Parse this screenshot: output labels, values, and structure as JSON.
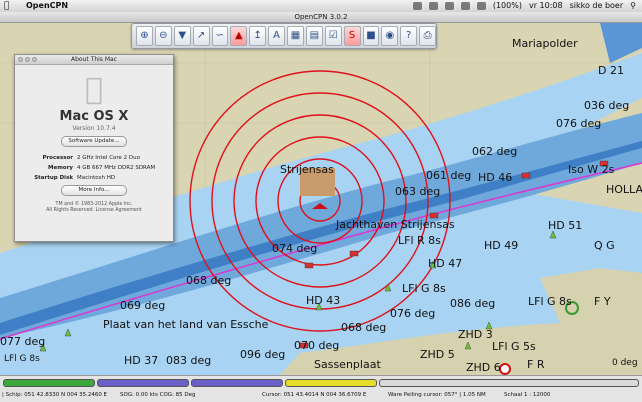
{
  "menubar": {
    "app": "OpenCPN",
    "battery": "(100%)",
    "clock": "vr 10:08",
    "user": "sikko de boer"
  },
  "window": {
    "title": "OpenCPN 3.0.2"
  },
  "toolbar": {
    "buttons": [
      "zoom-in",
      "zoom-out",
      "course-up",
      "route",
      "track",
      "pirate",
      "measure",
      "text",
      "cm93",
      "tide",
      "settings",
      "drop-mark",
      "ais",
      "help",
      "print",
      "quit"
    ]
  },
  "about": {
    "title": "About This Mac",
    "os": "Mac OS X",
    "version": "Version 10.7.4",
    "update_button": "Software Update...",
    "processor_label": "Processor",
    "processor": "2 GHz Intel Core 2 Duo",
    "memory_label": "Memory",
    "memory": "4 GB 667 MHz DDR2 SDRAM",
    "disk_label": "Startup Disk",
    "disk": "Macintosh HD",
    "more_button": "More Info...",
    "footer1": "TM and © 1983-2012 Apple Inc.",
    "footer2": "All Rights Reserved.  License Agreement"
  },
  "chart_labels": [
    "Mariapolder",
    "D 21",
    "036 deg",
    "076 deg",
    "062 deg",
    "061 deg",
    "HD 46",
    "Iso W 2s",
    "HOLLA",
    "063 deg",
    "Strijensas",
    "Jachthaven Strijensas",
    "LFl R 8s",
    "HD 51",
    "074 deg",
    "HD 49",
    "Q G",
    "HD 47",
    "068 deg",
    "LFl G 8s",
    "069 deg",
    "HD 43",
    "086 deg",
    "LFl G 8s",
    "F Y",
    "076 deg",
    "Plaat van het land van Essche",
    "068 deg",
    "ZHD 3",
    "077 deg",
    "070 deg",
    "LFl G 5s",
    "HD 37",
    "083 deg",
    "096 deg",
    "Sassenplaat",
    "ZHD 5",
    "ZHD 6",
    "F R",
    "LFl G 8s",
    "0 deg"
  ],
  "status": {
    "ship": "| Schip: 051 42.8330 N   004 35.2460 E",
    "sog": "SOG:   0.00 kts   COG:   85 Deg",
    "cursor": "Cursor: 051 43.4014 N   004 36.6709 E",
    "bearing": "Ware Peiling cursor: 057° |  1.05 NM",
    "scale": "Schaal 1 :    12000"
  },
  "colors": {
    "water": "#a9d3f0",
    "deep": "#3b78c0",
    "land": "#d6d2b0",
    "rings": "#e0101a",
    "route": "#d63cd0"
  }
}
